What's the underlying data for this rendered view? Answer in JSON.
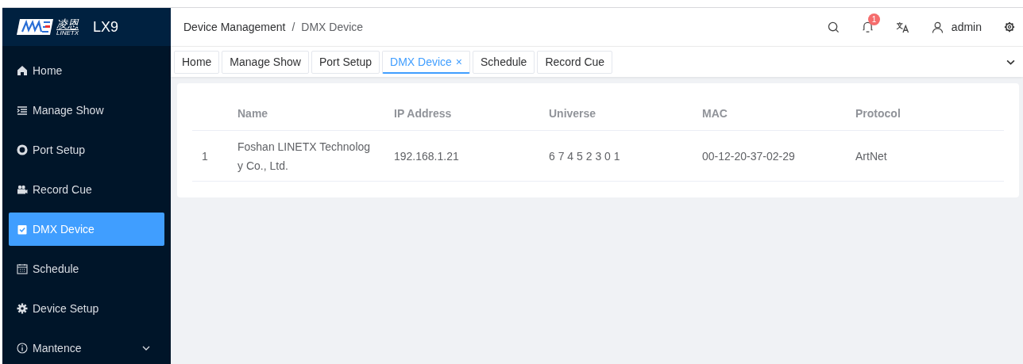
{
  "logo": {
    "cn": "凌恩",
    "en": "LINETX",
    "product": "LX9"
  },
  "sidebar": {
    "items": [
      {
        "label": "Home",
        "selected": false
      },
      {
        "label": "Manage Show",
        "selected": false
      },
      {
        "label": "Port Setup",
        "selected": false
      },
      {
        "label": "Record Cue",
        "selected": false
      },
      {
        "label": "DMX Device",
        "selected": true
      },
      {
        "label": "Schedule",
        "selected": false
      },
      {
        "label": "Device Setup",
        "selected": false
      },
      {
        "label": "Mantence",
        "selected": false,
        "expanded": false
      }
    ]
  },
  "breadcrumb": [
    "Device Management",
    "DMX Device"
  ],
  "breadcrumb_separator": "/",
  "header": {
    "notification_count": "1",
    "user": "admin"
  },
  "tabs": [
    {
      "label": "Home",
      "selected": false
    },
    {
      "label": "Manage Show",
      "selected": false
    },
    {
      "label": "Port Setup",
      "selected": false
    },
    {
      "label": "DMX Device",
      "selected": true,
      "close": "×"
    },
    {
      "label": "Schedule",
      "selected": false
    },
    {
      "label": "Record Cue",
      "selected": false
    }
  ],
  "table": {
    "columns": [
      "Name",
      "IP Address",
      "Universe",
      "MAC",
      "Protocol"
    ],
    "rows": [
      {
        "index": "1",
        "cells": [
          "Foshan LINETX Technology Co., Ltd.",
          "192.168.1.21",
          "6 7 4 5 2 3 0 1",
          "00-12-20-37-02-29",
          "ArtNet"
        ]
      }
    ]
  }
}
